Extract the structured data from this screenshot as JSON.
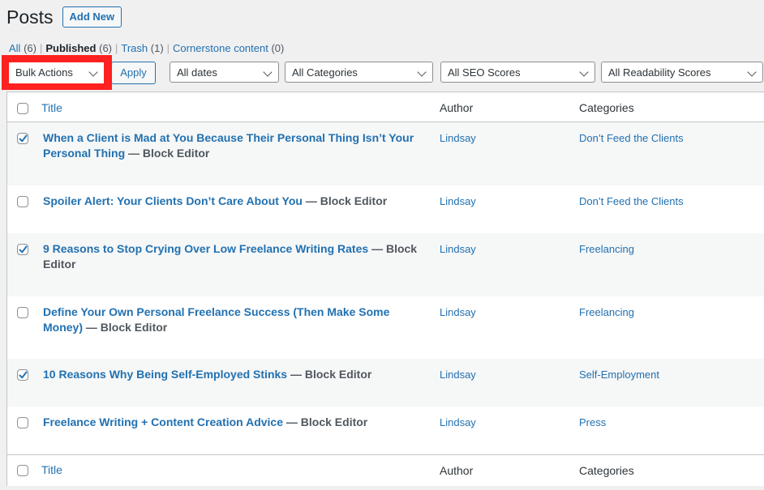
{
  "header": {
    "title": "Posts",
    "add_new_label": "Add New"
  },
  "views": [
    {
      "label": "All",
      "count": "(6)",
      "current": false
    },
    {
      "label": "Published",
      "count": "(6)",
      "current": true
    },
    {
      "label": "Trash",
      "count": "(1)",
      "current": false
    },
    {
      "label": "Cornerstone content",
      "count": "(0)",
      "current": false
    }
  ],
  "tablenav": {
    "bulk_actions": "Bulk Actions",
    "apply_label": "Apply",
    "filters": {
      "dates": "All dates",
      "categories": "All Categories",
      "seo": "All SEO Scores",
      "readability": "All Readability Scores"
    },
    "highlight_color": "#ff2020"
  },
  "table": {
    "columns": {
      "title": "Title",
      "author": "Author",
      "categories": "Categories"
    },
    "rows": [
      {
        "title": "When a Client is Mad at You Because Their Personal Thing Isn’t Your Personal Thing",
        "state": "— Block Editor",
        "author": "Lindsay",
        "category": "Don’t Feed the Clients",
        "checked": true
      },
      {
        "title": "Spoiler Alert: Your Clients Don’t Care About You",
        "state": "— Block Editor",
        "author": "Lindsay",
        "category": "Don’t Feed the Clients",
        "checked": false
      },
      {
        "title": "9 Reasons to Stop Crying Over Low Freelance Writing Rates",
        "state": "— Block Editor",
        "author": "Lindsay",
        "category": "Freelancing",
        "checked": true
      },
      {
        "title": "Define Your Own Personal Freelance Success (Then Make Some Money)",
        "state": "— Block Editor",
        "author": "Lindsay",
        "category": "Freelancing",
        "checked": false
      },
      {
        "title": "10 Reasons Why Being Self-Employed Stinks",
        "state": "— Block Editor",
        "author": "Lindsay",
        "category": "Self-Employment",
        "checked": true
      },
      {
        "title": "Freelance Writing + Content Creation Advice",
        "state": "— Block Editor",
        "author": "Lindsay",
        "category": "Press",
        "checked": false
      }
    ]
  },
  "colors": {
    "link": "#2271b1",
    "background": "#f0f0f1",
    "stripe": "#f6f7f7"
  }
}
